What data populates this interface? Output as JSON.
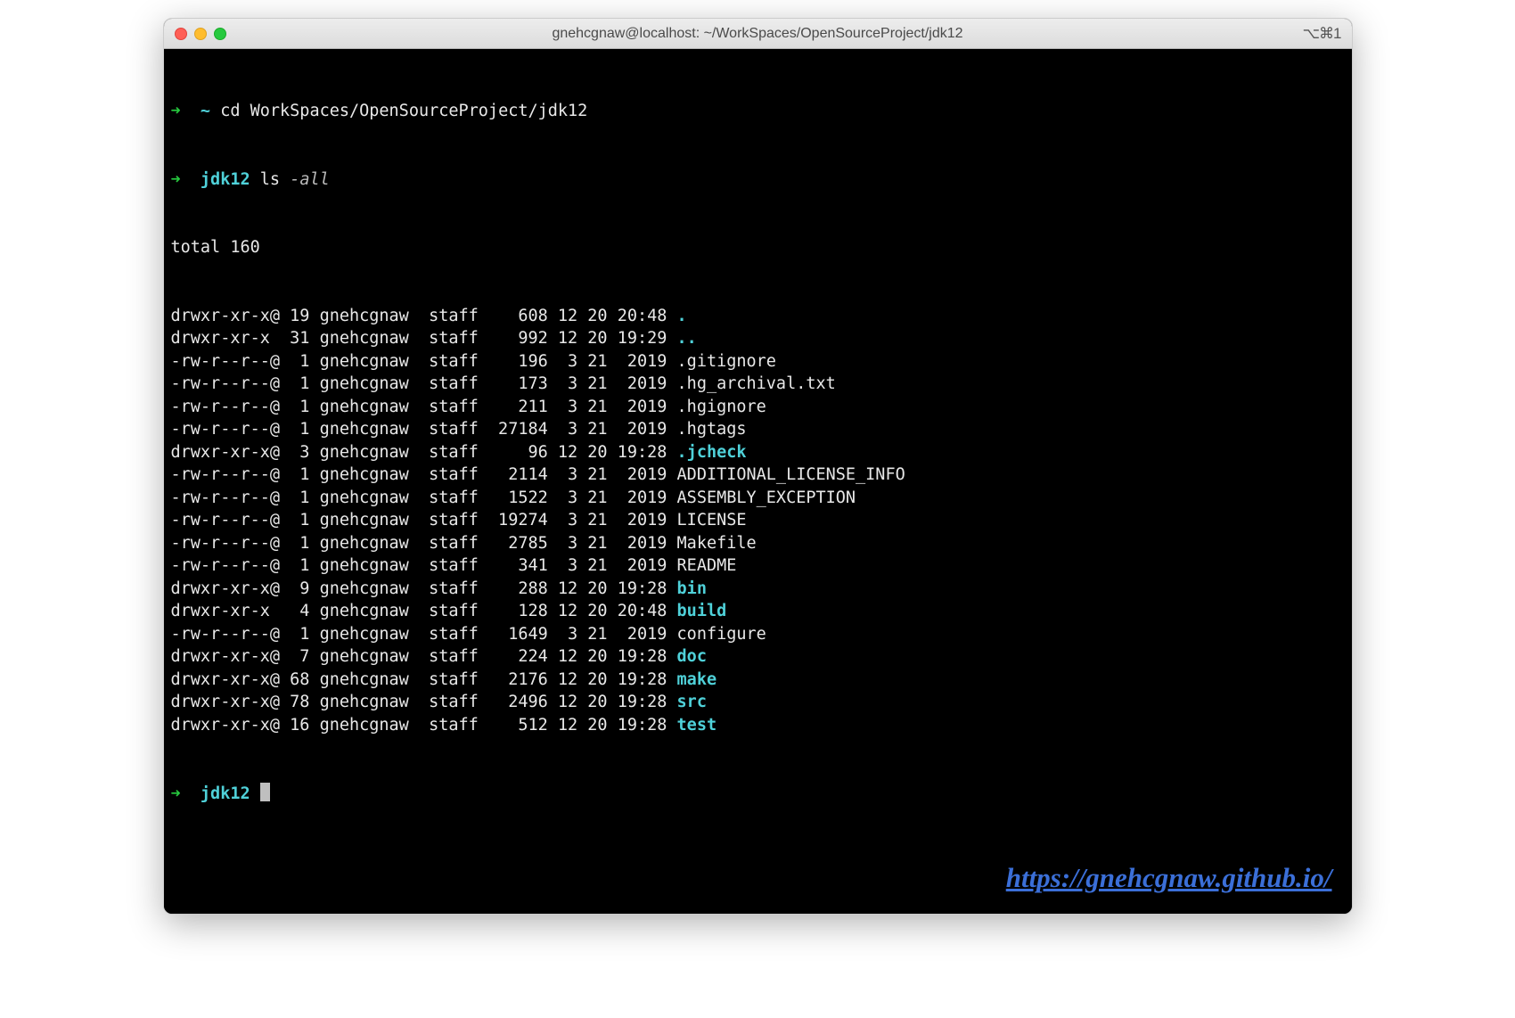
{
  "window": {
    "title": "gnehcgnaw@localhost: ~/WorkSpaces/OpenSourceProject/jdk12",
    "shortcut": "⌥⌘1"
  },
  "prompt": {
    "arrow": "➜",
    "home": "~",
    "dirLabel": "jdk12"
  },
  "commands": {
    "cd": "cd WorkSpaces/OpenSourceProject/jdk12",
    "ls": "ls",
    "lsFlag": "-all"
  },
  "listing": {
    "total": "total 160",
    "rows": [
      {
        "perm": "drwxr-xr-x@",
        "links": "19",
        "owner": "gnehcgnaw",
        "group": "staff",
        "size": "608",
        "mon": "12",
        "day": "20",
        "time": "20:48",
        "name": ".",
        "dir": true
      },
      {
        "perm": "drwxr-xr-x ",
        "links": "31",
        "owner": "gnehcgnaw",
        "group": "staff",
        "size": "992",
        "mon": "12",
        "day": "20",
        "time": "19:29",
        "name": "..",
        "dir": true
      },
      {
        "perm": "-rw-r--r--@",
        "links": "1",
        "owner": "gnehcgnaw",
        "group": "staff",
        "size": "196",
        "mon": "3",
        "day": "21",
        "time": "2019",
        "name": ".gitignore",
        "dir": false
      },
      {
        "perm": "-rw-r--r--@",
        "links": "1",
        "owner": "gnehcgnaw",
        "group": "staff",
        "size": "173",
        "mon": "3",
        "day": "21",
        "time": "2019",
        "name": ".hg_archival.txt",
        "dir": false
      },
      {
        "perm": "-rw-r--r--@",
        "links": "1",
        "owner": "gnehcgnaw",
        "group": "staff",
        "size": "211",
        "mon": "3",
        "day": "21",
        "time": "2019",
        "name": ".hgignore",
        "dir": false
      },
      {
        "perm": "-rw-r--r--@",
        "links": "1",
        "owner": "gnehcgnaw",
        "group": "staff",
        "size": "27184",
        "mon": "3",
        "day": "21",
        "time": "2019",
        "name": ".hgtags",
        "dir": false
      },
      {
        "perm": "drwxr-xr-x@",
        "links": "3",
        "owner": "gnehcgnaw",
        "group": "staff",
        "size": "96",
        "mon": "12",
        "day": "20",
        "time": "19:28",
        "name": ".jcheck",
        "dir": true
      },
      {
        "perm": "-rw-r--r--@",
        "links": "1",
        "owner": "gnehcgnaw",
        "group": "staff",
        "size": "2114",
        "mon": "3",
        "day": "21",
        "time": "2019",
        "name": "ADDITIONAL_LICENSE_INFO",
        "dir": false
      },
      {
        "perm": "-rw-r--r--@",
        "links": "1",
        "owner": "gnehcgnaw",
        "group": "staff",
        "size": "1522",
        "mon": "3",
        "day": "21",
        "time": "2019",
        "name": "ASSEMBLY_EXCEPTION",
        "dir": false
      },
      {
        "perm": "-rw-r--r--@",
        "links": "1",
        "owner": "gnehcgnaw",
        "group": "staff",
        "size": "19274",
        "mon": "3",
        "day": "21",
        "time": "2019",
        "name": "LICENSE",
        "dir": false
      },
      {
        "perm": "-rw-r--r--@",
        "links": "1",
        "owner": "gnehcgnaw",
        "group": "staff",
        "size": "2785",
        "mon": "3",
        "day": "21",
        "time": "2019",
        "name": "Makefile",
        "dir": false
      },
      {
        "perm": "-rw-r--r--@",
        "links": "1",
        "owner": "gnehcgnaw",
        "group": "staff",
        "size": "341",
        "mon": "3",
        "day": "21",
        "time": "2019",
        "name": "README",
        "dir": false
      },
      {
        "perm": "drwxr-xr-x@",
        "links": "9",
        "owner": "gnehcgnaw",
        "group": "staff",
        "size": "288",
        "mon": "12",
        "day": "20",
        "time": "19:28",
        "name": "bin",
        "dir": true
      },
      {
        "perm": "drwxr-xr-x ",
        "links": "4",
        "owner": "gnehcgnaw",
        "group": "staff",
        "size": "128",
        "mon": "12",
        "day": "20",
        "time": "20:48",
        "name": "build",
        "dir": true
      },
      {
        "perm": "-rw-r--r--@",
        "links": "1",
        "owner": "gnehcgnaw",
        "group": "staff",
        "size": "1649",
        "mon": "3",
        "day": "21",
        "time": "2019",
        "name": "configure",
        "dir": false
      },
      {
        "perm": "drwxr-xr-x@",
        "links": "7",
        "owner": "gnehcgnaw",
        "group": "staff",
        "size": "224",
        "mon": "12",
        "day": "20",
        "time": "19:28",
        "name": "doc",
        "dir": true
      },
      {
        "perm": "drwxr-xr-x@",
        "links": "68",
        "owner": "gnehcgnaw",
        "group": "staff",
        "size": "2176",
        "mon": "12",
        "day": "20",
        "time": "19:28",
        "name": "make",
        "dir": true
      },
      {
        "perm": "drwxr-xr-x@",
        "links": "78",
        "owner": "gnehcgnaw",
        "group": "staff",
        "size": "2496",
        "mon": "12",
        "day": "20",
        "time": "19:28",
        "name": "src",
        "dir": true
      },
      {
        "perm": "drwxr-xr-x@",
        "links": "16",
        "owner": "gnehcgnaw",
        "group": "staff",
        "size": "512",
        "mon": "12",
        "day": "20",
        "time": "19:28",
        "name": "test",
        "dir": true
      }
    ]
  },
  "watermark": "https://gnehcgnaw.github.io/"
}
